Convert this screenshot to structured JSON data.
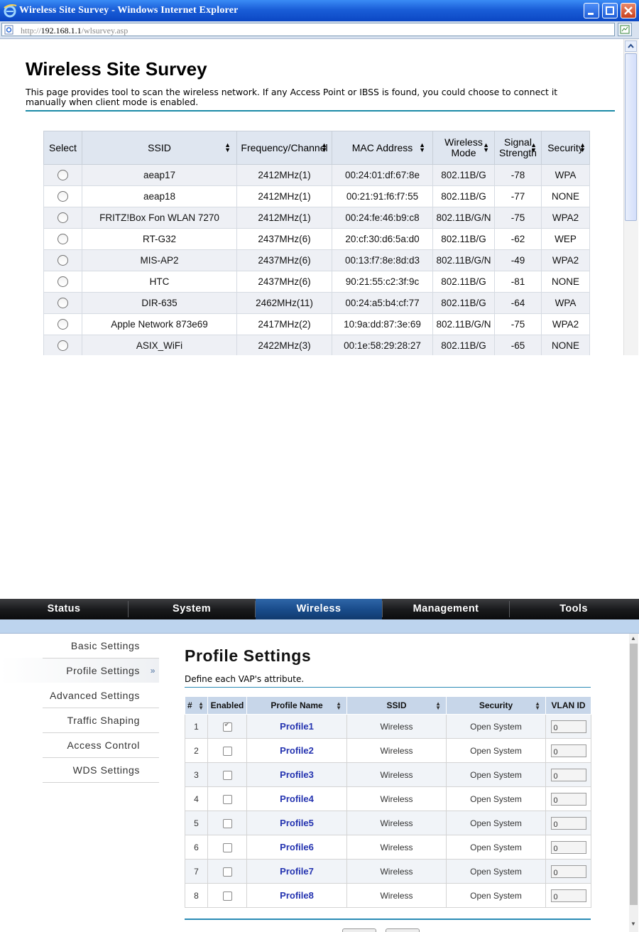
{
  "browser": {
    "window_title": "Wireless Site Survey - Windows Internet Explorer",
    "url_prefix": "http://",
    "url_host": "192.168.1.1",
    "url_path": "/wlsurvey.asp"
  },
  "survey": {
    "title": "Wireless Site Survey",
    "description": "This page provides tool to scan the wireless network. If any Access Point or IBSS is found, you could choose to connect it manually when client mode is enabled.",
    "columns": {
      "select": "Select",
      "ssid": "SSID",
      "frequency": "Frequency/Channel",
      "mac": "MAC Address",
      "mode_line1": "Wireless",
      "mode_line2": "Mode",
      "signal_line1": "Signal",
      "signal_line2": "Strength",
      "security": "Security"
    },
    "rows": [
      {
        "ssid": "aeap17",
        "frequency": "2412MHz(1)",
        "mac": "00:24:01:df:67:8e",
        "mode": "802.11B/G",
        "signal": "-78",
        "security": "WPA"
      },
      {
        "ssid": "aeap18",
        "frequency": "2412MHz(1)",
        "mac": "00:21:91:f6:f7:55",
        "mode": "802.11B/G",
        "signal": "-77",
        "security": "NONE"
      },
      {
        "ssid": "FRITZ!Box Fon WLAN 7270",
        "frequency": "2412MHz(1)",
        "mac": "00:24:fe:46:b9:c8",
        "mode": "802.11B/G/N",
        "signal": "-75",
        "security": "WPA2"
      },
      {
        "ssid": "RT-G32",
        "frequency": "2437MHz(6)",
        "mac": "20:cf:30:d6:5a:d0",
        "mode": "802.11B/G",
        "signal": "-62",
        "security": "WEP"
      },
      {
        "ssid": "MIS-AP2",
        "frequency": "2437MHz(6)",
        "mac": "00:13:f7:8e:8d:d3",
        "mode": "802.11B/G/N",
        "signal": "-49",
        "security": "WPA2"
      },
      {
        "ssid": "HTC",
        "frequency": "2437MHz(6)",
        "mac": "90:21:55:c2:3f:9c",
        "mode": "802.11B/G",
        "signal": "-81",
        "security": "NONE"
      },
      {
        "ssid": "DIR-635",
        "frequency": "2462MHz(11)",
        "mac": "00:24:a5:b4:cf:77",
        "mode": "802.11B/G",
        "signal": "-64",
        "security": "WPA"
      },
      {
        "ssid": "Apple Network 873e69",
        "frequency": "2417MHz(2)",
        "mac": "10:9a:dd:87:3e:69",
        "mode": "802.11B/G/N",
        "signal": "-75",
        "security": "WPA2"
      },
      {
        "ssid": "ASIX_WiFi",
        "frequency": "2422MHz(3)",
        "mac": "00:1e:58:29:28:27",
        "mode": "802.11B/G",
        "signal": "-65",
        "security": "NONE"
      }
    ]
  },
  "router": {
    "nav_tabs": [
      "Status",
      "System",
      "Wireless",
      "Management",
      "Tools"
    ],
    "active_tab": "Wireless",
    "sidebar": [
      {
        "label": "Basic Settings",
        "active": false
      },
      {
        "label": "Profile Settings",
        "active": true
      },
      {
        "label": "Advanced Settings",
        "active": false
      },
      {
        "label": "Traffic Shaping",
        "active": false
      },
      {
        "label": "Access Control",
        "active": false
      },
      {
        "label": "WDS Settings",
        "active": false
      }
    ],
    "profile": {
      "title": "Profile Settings",
      "description": "Define each VAP's attribute.",
      "columns": {
        "num": "#",
        "enabled": "Enabled",
        "name": "Profile Name",
        "ssid": "SSID",
        "security": "Security",
        "vlan": "VLAN ID"
      },
      "rows": [
        {
          "num": "1",
          "enabled": true,
          "name": "Profile1",
          "ssid": "Wireless",
          "security": "Open System",
          "vlan": "0"
        },
        {
          "num": "2",
          "enabled": false,
          "name": "Profile2",
          "ssid": "Wireless",
          "security": "Open System",
          "vlan": "0"
        },
        {
          "num": "3",
          "enabled": false,
          "name": "Profile3",
          "ssid": "Wireless",
          "security": "Open System",
          "vlan": "0"
        },
        {
          "num": "4",
          "enabled": false,
          "name": "Profile4",
          "ssid": "Wireless",
          "security": "Open System",
          "vlan": "0"
        },
        {
          "num": "5",
          "enabled": false,
          "name": "Profile5",
          "ssid": "Wireless",
          "security": "Open System",
          "vlan": "0"
        },
        {
          "num": "6",
          "enabled": false,
          "name": "Profile6",
          "ssid": "Wireless",
          "security": "Open System",
          "vlan": "0"
        },
        {
          "num": "7",
          "enabled": false,
          "name": "Profile7",
          "ssid": "Wireless",
          "security": "Open System",
          "vlan": "0"
        },
        {
          "num": "8",
          "enabled": false,
          "name": "Profile8",
          "ssid": "Wireless",
          "security": "Open System",
          "vlan": "0"
        }
      ]
    }
  },
  "icons": {
    "ie_logo": "ie-logo-icon",
    "minimize": "minimize-icon",
    "maximize": "maximize-icon",
    "close": "close-icon",
    "page": "page-icon",
    "compat": "compatibility-view-icon",
    "sort": "sort-arrows-icon",
    "submenu_arrow": "double-chevron-right-icon"
  },
  "colors": {
    "title_bar": "#1a5ed8",
    "accent_rule": "#1b8aa6",
    "profile_link": "#2433b0",
    "nav_active": "#1a4d8c"
  }
}
